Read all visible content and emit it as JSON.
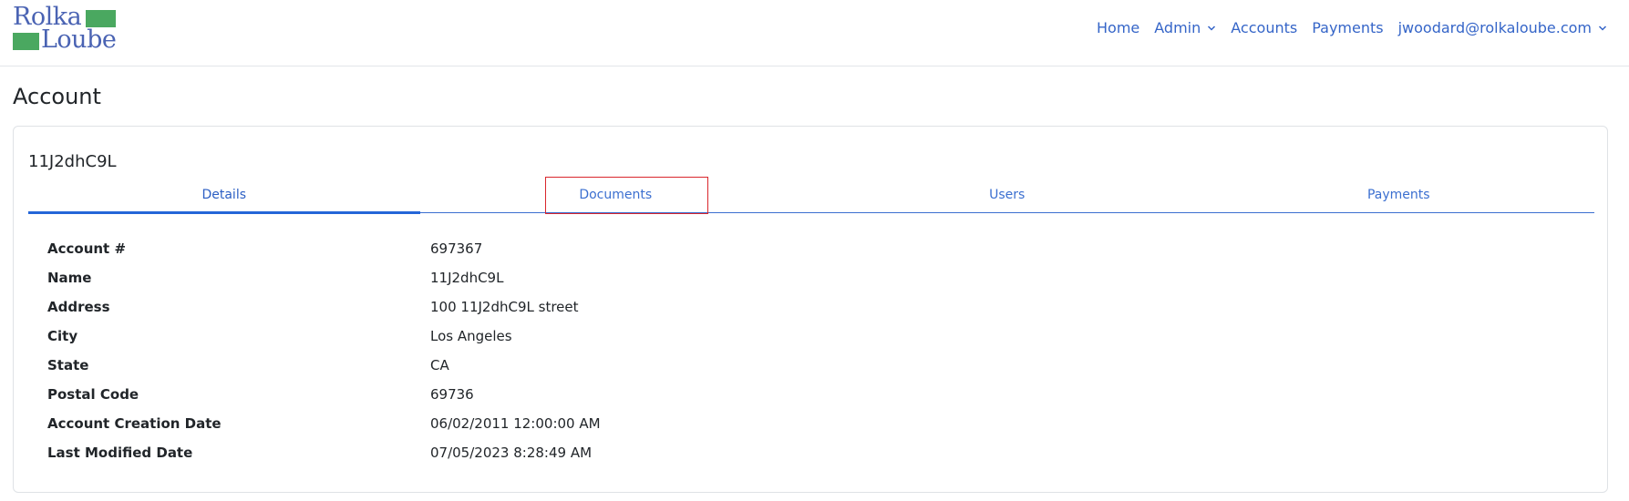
{
  "brand": {
    "line1": "Rolka",
    "line2": "Loube",
    "color_text": "#4a63b3",
    "color_block": "#4aa860"
  },
  "nav": {
    "home": "Home",
    "admin": "Admin",
    "accounts": "Accounts",
    "payments": "Payments",
    "user": "jwoodard@rolkaloube.com",
    "link_color": "#3565c8"
  },
  "page": {
    "title": "Account"
  },
  "account": {
    "heading": "11J2dhC9L",
    "tabs": [
      "Details",
      "Documents",
      "Users",
      "Payments"
    ],
    "active_tab": "Details",
    "details": [
      {
        "label": "Account #",
        "value": "697367"
      },
      {
        "label": "Name",
        "value": "11J2dhC9L"
      },
      {
        "label": "Address",
        "value": "100 11J2dhC9L street"
      },
      {
        "label": "City",
        "value": "Los Angeles"
      },
      {
        "label": "State",
        "value": "CA"
      },
      {
        "label": "Postal Code",
        "value": "69736"
      },
      {
        "label": "Account Creation Date",
        "value": "06/02/2011 12:00:00 AM"
      },
      {
        "label": "Last Modified Date",
        "value": "07/05/2023 8:28:49 AM"
      }
    ]
  },
  "colors": {
    "accent": "#2466d8",
    "highlight_box": "#d9262c"
  }
}
